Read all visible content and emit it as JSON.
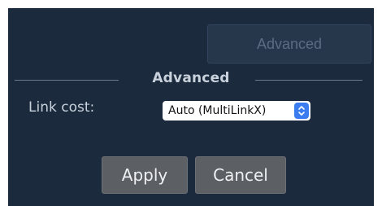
{
  "top_button": {
    "label": "Advanced"
  },
  "section": {
    "title": "Advanced"
  },
  "link_cost": {
    "label": "Link cost:",
    "selected": "Auto (MultiLinkX)"
  },
  "actions": {
    "apply_label": "Apply",
    "cancel_label": "Cancel"
  },
  "colors": {
    "panel_bg": "#1b2a3d",
    "button_bg": "#5c5f63",
    "stepper_blue": "#3b7df0"
  },
  "icons": {
    "select_stepper": "chevron-up-down-icon"
  }
}
